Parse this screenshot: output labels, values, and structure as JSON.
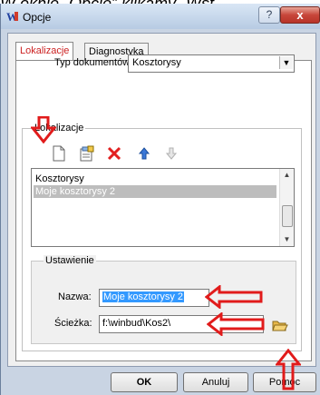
{
  "caption_fragment": "W oknie „Opcje” klikamy „Wst",
  "window": {
    "title": "Opcje",
    "help_glyph": "?",
    "close_glyph": "x"
  },
  "tabs": [
    {
      "label": "Lokalizacje",
      "active": true
    },
    {
      "label": "Diagnostyka",
      "active": false
    }
  ],
  "typ_dokumentow": {
    "label": "Typ dokumentów:",
    "value": "Kosztorysy"
  },
  "lokalizacje": {
    "group_label": "Lokalizacje",
    "toolbar": [
      "new-document-icon",
      "properties-icon",
      "delete-icon",
      "move-up-icon",
      "move-down-icon"
    ],
    "items": [
      {
        "label": "Kosztorysy",
        "selected": false
      },
      {
        "label": "Moje kosztorysy 2",
        "selected": true
      }
    ]
  },
  "ustawienie": {
    "group_label": "Ustawienie",
    "nazwa_label": "Nazwa:",
    "nazwa_value": "Moje kosztorysy 2",
    "sciezka_label": "Ścieżka:",
    "sciezka_value": "f:\\winbud\\Kos2\\"
  },
  "buttons": {
    "ok": "OK",
    "anuluj": "Anuluj",
    "pomoc": "Pomoc"
  },
  "colors": {
    "annotation_red": "#e11b1b",
    "active_tab_text": "#cc2222",
    "selection_blue": "#3399ff"
  }
}
